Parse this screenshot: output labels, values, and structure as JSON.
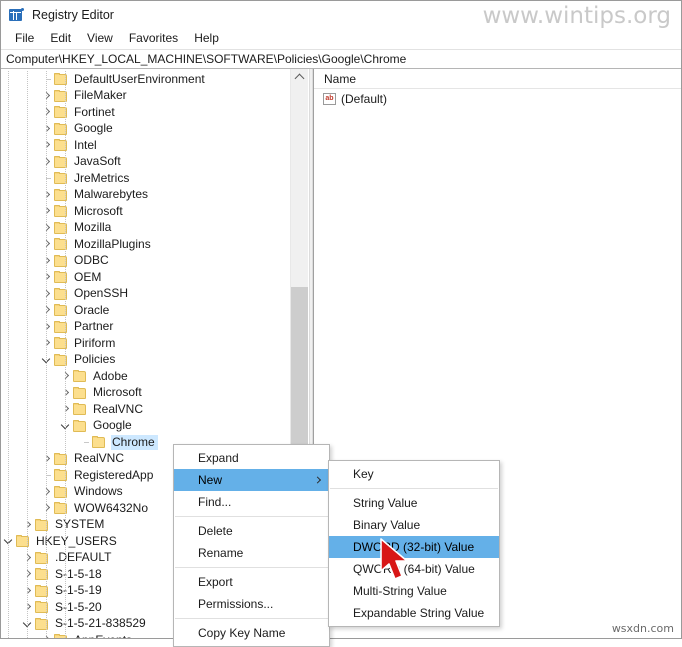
{
  "window": {
    "title": "Registry Editor",
    "icon": "registry-editor-icon"
  },
  "watermarks": {
    "top": "www.wintips.org",
    "bottom": "wsxdn.com"
  },
  "menubar": {
    "items": [
      {
        "label": "File"
      },
      {
        "label": "Edit"
      },
      {
        "label": "View"
      },
      {
        "label": "Favorites"
      },
      {
        "label": "Help"
      }
    ]
  },
  "address": {
    "path": "Computer\\HKEY_LOCAL_MACHINE\\SOFTWARE\\Policies\\Google\\Chrome"
  },
  "tree": {
    "nodes": [
      {
        "label": "DefaultUserEnvironment",
        "indent": 3,
        "state": "leaf",
        "selected": false
      },
      {
        "label": "FileMaker",
        "indent": 3,
        "state": "closed",
        "selected": false
      },
      {
        "label": "Fortinet",
        "indent": 3,
        "state": "closed",
        "selected": false
      },
      {
        "label": "Google",
        "indent": 3,
        "state": "closed",
        "selected": false
      },
      {
        "label": "Intel",
        "indent": 3,
        "state": "closed",
        "selected": false
      },
      {
        "label": "JavaSoft",
        "indent": 3,
        "state": "closed",
        "selected": false
      },
      {
        "label": "JreMetrics",
        "indent": 3,
        "state": "leaf",
        "selected": false
      },
      {
        "label": "Malwarebytes",
        "indent": 3,
        "state": "closed",
        "selected": false
      },
      {
        "label": "Microsoft",
        "indent": 3,
        "state": "closed",
        "selected": false
      },
      {
        "label": "Mozilla",
        "indent": 3,
        "state": "closed",
        "selected": false
      },
      {
        "label": "MozillaPlugins",
        "indent": 3,
        "state": "closed",
        "selected": false
      },
      {
        "label": "ODBC",
        "indent": 3,
        "state": "closed",
        "selected": false
      },
      {
        "label": "OEM",
        "indent": 3,
        "state": "closed",
        "selected": false
      },
      {
        "label": "OpenSSH",
        "indent": 3,
        "state": "closed",
        "selected": false
      },
      {
        "label": "Oracle",
        "indent": 3,
        "state": "closed",
        "selected": false
      },
      {
        "label": "Partner",
        "indent": 3,
        "state": "closed",
        "selected": false
      },
      {
        "label": "Piriform",
        "indent": 3,
        "state": "closed",
        "selected": false
      },
      {
        "label": "Policies",
        "indent": 3,
        "state": "open",
        "selected": false
      },
      {
        "label": "Adobe",
        "indent": 4,
        "state": "closed",
        "selected": false
      },
      {
        "label": "Microsoft",
        "indent": 4,
        "state": "closed",
        "selected": false
      },
      {
        "label": "RealVNC",
        "indent": 4,
        "state": "closed",
        "selected": false
      },
      {
        "label": "Google",
        "indent": 4,
        "state": "open",
        "selected": false
      },
      {
        "label": "Chrome",
        "indent": 5,
        "state": "leaf",
        "selected": true
      },
      {
        "label": "RealVNC",
        "indent": 3,
        "state": "closed",
        "selected": false
      },
      {
        "label": "RegisteredApp",
        "indent": 3,
        "state": "leaf",
        "selected": false
      },
      {
        "label": "Windows",
        "indent": 3,
        "state": "closed",
        "selected": false
      },
      {
        "label": "WOW6432No",
        "indent": 3,
        "state": "closed",
        "selected": false
      },
      {
        "label": "SYSTEM",
        "indent": 2,
        "state": "closed",
        "selected": false
      },
      {
        "label": "HKEY_USERS",
        "indent": 1,
        "state": "open",
        "selected": false
      },
      {
        "label": ".DEFAULT",
        "indent": 2,
        "state": "closed",
        "selected": false
      },
      {
        "label": "S-1-5-18",
        "indent": 2,
        "state": "closed",
        "selected": false
      },
      {
        "label": "S-1-5-19",
        "indent": 2,
        "state": "closed",
        "selected": false
      },
      {
        "label": "S-1-5-20",
        "indent": 2,
        "state": "closed",
        "selected": false
      },
      {
        "label": "S-1-5-21-838529",
        "indent": 2,
        "state": "open",
        "selected": false
      },
      {
        "label": "AppEvents",
        "indent": 3,
        "state": "closed",
        "selected": false
      }
    ]
  },
  "list": {
    "columns": [
      "Name"
    ],
    "rows": [
      {
        "icon": "string-value-icon",
        "name": "(Default)"
      }
    ]
  },
  "context_menu": {
    "items": [
      {
        "label": "Expand",
        "highlighted": false,
        "submenu": false
      },
      {
        "label": "New",
        "highlighted": true,
        "submenu": true
      },
      {
        "label": "Find...",
        "highlighted": false,
        "submenu": false
      },
      {
        "sep": true
      },
      {
        "label": "Delete",
        "highlighted": false,
        "submenu": false
      },
      {
        "label": "Rename",
        "highlighted": false,
        "submenu": false
      },
      {
        "sep": true
      },
      {
        "label": "Export",
        "highlighted": false,
        "submenu": false
      },
      {
        "label": "Permissions...",
        "highlighted": false,
        "submenu": false
      },
      {
        "sep": true
      },
      {
        "label": "Copy Key Name",
        "highlighted": false,
        "submenu": false
      }
    ]
  },
  "submenu": {
    "items": [
      {
        "label": "Key",
        "highlighted": false
      },
      {
        "sep": true
      },
      {
        "label": "String Value",
        "highlighted": false
      },
      {
        "label": "Binary Value",
        "highlighted": false
      },
      {
        "label": "DWORD (32-bit) Value",
        "highlighted": true
      },
      {
        "label": "QWORD (64-bit) Value",
        "highlighted": false
      },
      {
        "label": "Multi-String Value",
        "highlighted": false
      },
      {
        "label": "Expandable String Value",
        "highlighted": false
      }
    ]
  },
  "colors": {
    "highlight": "#64b0e8",
    "selection": "#cde8ff",
    "folder": "#fcdf8e",
    "cursor": "#d81616"
  }
}
